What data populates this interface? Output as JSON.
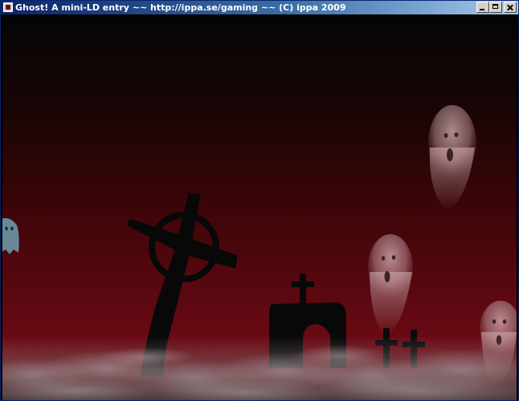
{
  "window": {
    "title": "Ghost! A mini-LD entry ~~ http://ippa.se/gaming ~~ (C) ippa 2009",
    "controls": [
      "minimize",
      "maximize",
      "close"
    ]
  },
  "scene": {
    "sky_top_color": "#050505",
    "sky_bottom_color": "#6e0a14",
    "silhouette_color": "#080808",
    "ghost_color": "#c8a8ac",
    "player_ghost_color": "#6fa3b8",
    "fog_color": "#9a8c8e",
    "objects": [
      "celtic-cross",
      "crypt-with-cross",
      "small-cross-left",
      "small-cross-right"
    ],
    "ghosts": [
      "ghost-upper-right",
      "ghost-middle-right",
      "ghost-lower-right",
      "player-ghost-left"
    ]
  }
}
